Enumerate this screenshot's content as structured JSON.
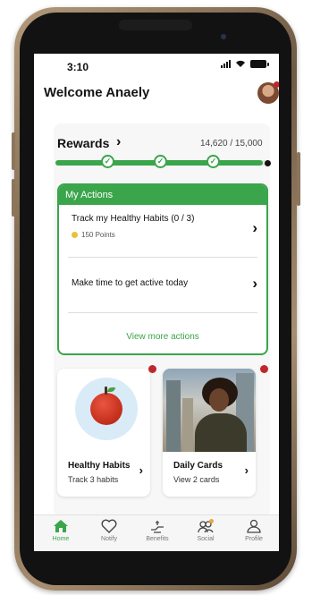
{
  "status_bar": {
    "time": "3:10"
  },
  "header": {
    "welcome": "Welcome Anaely"
  },
  "rewards": {
    "title": "Rewards",
    "points": "14,620 / 15,000",
    "progress_fraction": 0.975
  },
  "actions": {
    "header": "My Actions",
    "items": [
      {
        "title": "Track my Healthy Habits (0 / 3)",
        "points": "150 Points"
      },
      {
        "title": "Make time to get active today"
      }
    ],
    "view_more": "View more actions"
  },
  "tiles": [
    {
      "title": "Healthy Habits",
      "subtitle": "Track 3 habits"
    },
    {
      "title": "Daily Cards",
      "subtitle": "View 2 cards"
    }
  ],
  "nav": [
    {
      "label": "Home",
      "icon": "home-icon"
    },
    {
      "label": "Notify",
      "icon": "heart-icon"
    },
    {
      "label": "Benefits",
      "icon": "benefits-icon"
    },
    {
      "label": "Social",
      "icon": "social-icon"
    },
    {
      "label": "Profile",
      "icon": "profile-icon"
    }
  ],
  "colors": {
    "accent": "#3aa54a",
    "badge": "#c0272d"
  }
}
